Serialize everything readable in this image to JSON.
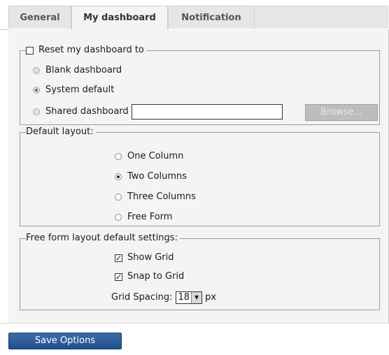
{
  "tabs": [
    {
      "label": "General"
    },
    {
      "label": "My dashboard"
    },
    {
      "label": "Notification"
    }
  ],
  "reset_section": {
    "label": "Reset my dashboard to",
    "options": [
      {
        "label": "Blank dashboard"
      },
      {
        "label": "System default"
      },
      {
        "label": "Shared dashboard"
      }
    ],
    "shared_input_value": "",
    "browse_label": "Browse..."
  },
  "default_layout": {
    "legend": "Default layout:",
    "options": [
      {
        "label": "One Column"
      },
      {
        "label": "Two Columns"
      },
      {
        "label": "Three Columns"
      },
      {
        "label": "Free Form"
      }
    ]
  },
  "free_form": {
    "legend": "Free form layout default settings:",
    "show_grid": "Show Grid",
    "snap_to_grid": "Snap to Grid",
    "grid_spacing_label": "Grid Spacing:",
    "grid_spacing_value": "18",
    "grid_spacing_unit": "px"
  },
  "save_button": "Save Options"
}
